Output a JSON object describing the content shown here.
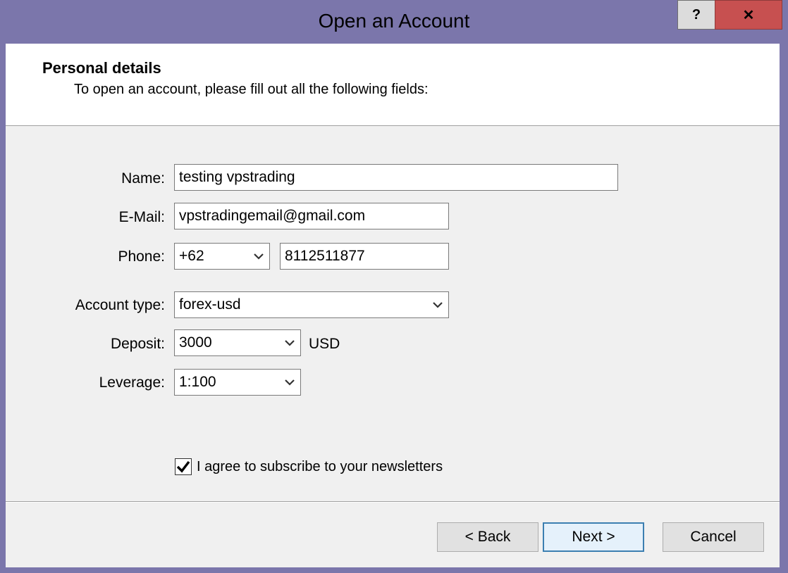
{
  "window": {
    "title": "Open an Account",
    "help_label": "?",
    "close_label": "✕"
  },
  "header": {
    "title": "Personal details",
    "subtitle": "To open an account, please fill out all the following fields:"
  },
  "form": {
    "name_label": "Name:",
    "name_value": "testing vpstrading",
    "email_label": "E-Mail:",
    "email_value": "vpstradingemail@gmail.com",
    "phone_label": "Phone:",
    "phone_code": "+62",
    "phone_number": "8112511877",
    "account_type_label": "Account type:",
    "account_type_value": "forex-usd",
    "deposit_label": "Deposit:",
    "deposit_value": "3000",
    "deposit_unit": "USD",
    "leverage_label": "Leverage:",
    "leverage_value": "1:100",
    "newsletter_label": "I agree to subscribe to your newsletters",
    "newsletter_checked": true
  },
  "buttons": {
    "back": "< Back",
    "next": "Next >",
    "cancel": "Cancel"
  },
  "colors": {
    "frame": "#7b76ab",
    "close": "#c75050",
    "client": "#f0f0f0"
  }
}
